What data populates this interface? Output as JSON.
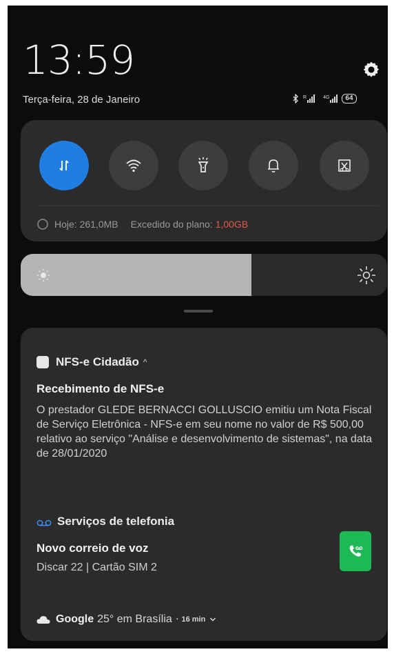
{
  "status": {
    "time": "13:59",
    "date": "Terça-feira, 28 de Janeiro",
    "network_label_1": "R",
    "network_label_2": "4G",
    "battery": "64"
  },
  "quick_settings": {
    "toggles": [
      {
        "name": "mobile-data",
        "active": true
      },
      {
        "name": "wifi",
        "active": false
      },
      {
        "name": "flashlight",
        "active": false
      },
      {
        "name": "sound",
        "active": false
      },
      {
        "name": "screenshot",
        "active": false
      }
    ],
    "data_today_label": "Hoje: 261,0MB",
    "over_plan_label": "Excedido do plano:",
    "over_plan_value": "1,00GB",
    "accent_color": "#1f7ee2",
    "over_color": "#e25a4b"
  },
  "brightness": {
    "level": 0.63
  },
  "notifications": {
    "nfse": {
      "app": "NFS-e Cidadão",
      "title": "Recebimento de NFS-e",
      "body": "O prestador GLEDE BERNACCI GOLLUSCIO emitiu um Nota Fiscal de Serviço Eletrônica - NFS-e em seu nome no valor de R$ 500,00 relativo ao serviço \"Análise e desenvolvimento de sistemas\", na data de 28/01/2020"
    },
    "telefonia": {
      "app": "Serviços de telefonia",
      "title": "Novo correio de voz",
      "detail": "Discar 22 | Cartão SIM 2",
      "action_color": "#1db954"
    },
    "google": {
      "app": "Google",
      "text": "25° em Brasília",
      "separator": "·",
      "time": "16 min"
    }
  }
}
